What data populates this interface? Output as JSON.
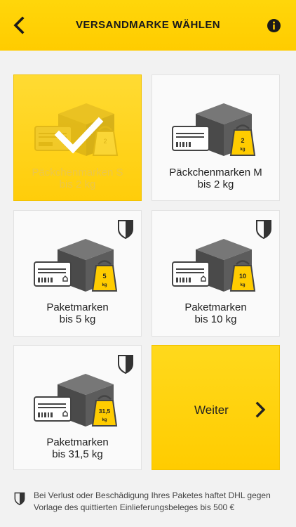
{
  "header": {
    "title": "VERSANDMARKE WÄHLEN"
  },
  "products": [
    {
      "name": "Päckchenmarken S",
      "weight": "bis 2 kg",
      "tag": "2",
      "insured": false,
      "selected": true
    },
    {
      "name": "Päckchenmarken M",
      "weight": "bis 2 kg",
      "tag": "2",
      "unit": "kg",
      "insured": false,
      "selected": false
    },
    {
      "name": "Paketmarken",
      "weight": "bis 5 kg",
      "tag": "5",
      "unit": "kg",
      "insured": true,
      "selected": false
    },
    {
      "name": "Paketmarken",
      "weight": "bis 10 kg",
      "tag": "10",
      "unit": "kg",
      "insured": true,
      "selected": false
    },
    {
      "name": "Paketmarken",
      "weight": "bis 31,5 kg",
      "tag": "31,5",
      "unit": "kg",
      "insured": true,
      "selected": false
    }
  ],
  "cta": {
    "label": "Weiter"
  },
  "footer": {
    "note": "Bei Verlust oder Beschädigung Ihres Paketes haftet DHL gegen Vorlage des quittierten Einlieferungsbeleges bis 500 €"
  },
  "colors": {
    "brand_yellow": "#ffcc00",
    "icon_gray": "#555555",
    "text_dark": "#222222"
  },
  "icons": {
    "back": "chevron-left-icon",
    "info": "info-icon",
    "insurance": "shield-icon",
    "next": "chevron-right-icon",
    "selected": "checkmark-icon"
  }
}
